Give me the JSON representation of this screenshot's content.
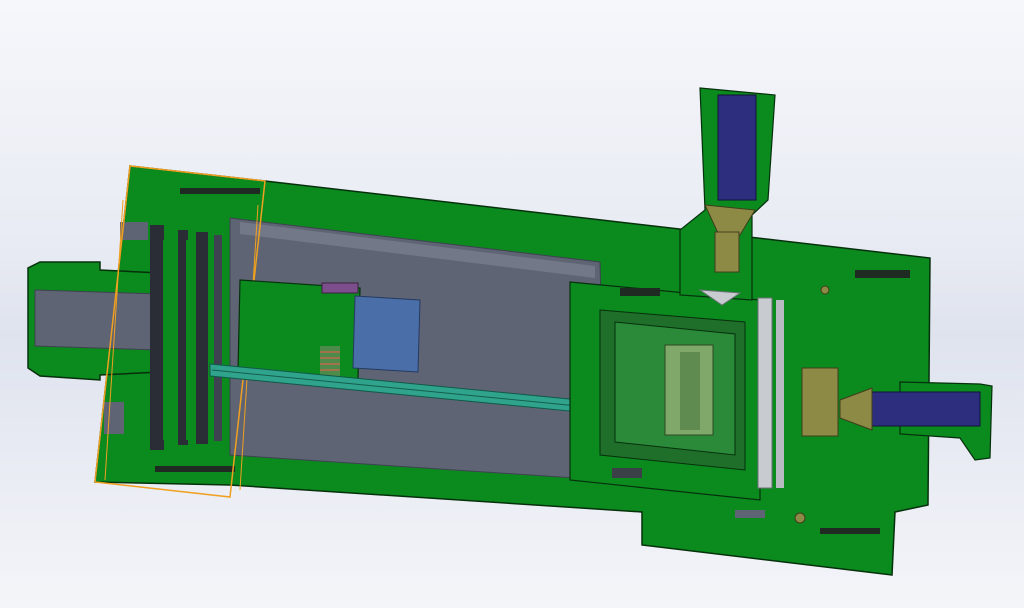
{
  "viewport": {
    "background_top": "#f6f7fb",
    "background_mid": "#dfe3ee"
  },
  "model": {
    "view_type": "section-view",
    "component": "cylinder-assembly",
    "colors": {
      "section_fill": "#0b8a1e",
      "section_outline": "#06300c",
      "inner_bore": "#5f6474",
      "bore_shadow": "#3e4250",
      "blue_part": "#2d2f7e",
      "steel_blue": "#4a6ea8",
      "brass": "#8c8a45",
      "teal_rod": "#2fa38c",
      "selection_outline": "#f0a020",
      "light_grey": "#c8ccd0",
      "purple": "#7d4e8c"
    }
  }
}
